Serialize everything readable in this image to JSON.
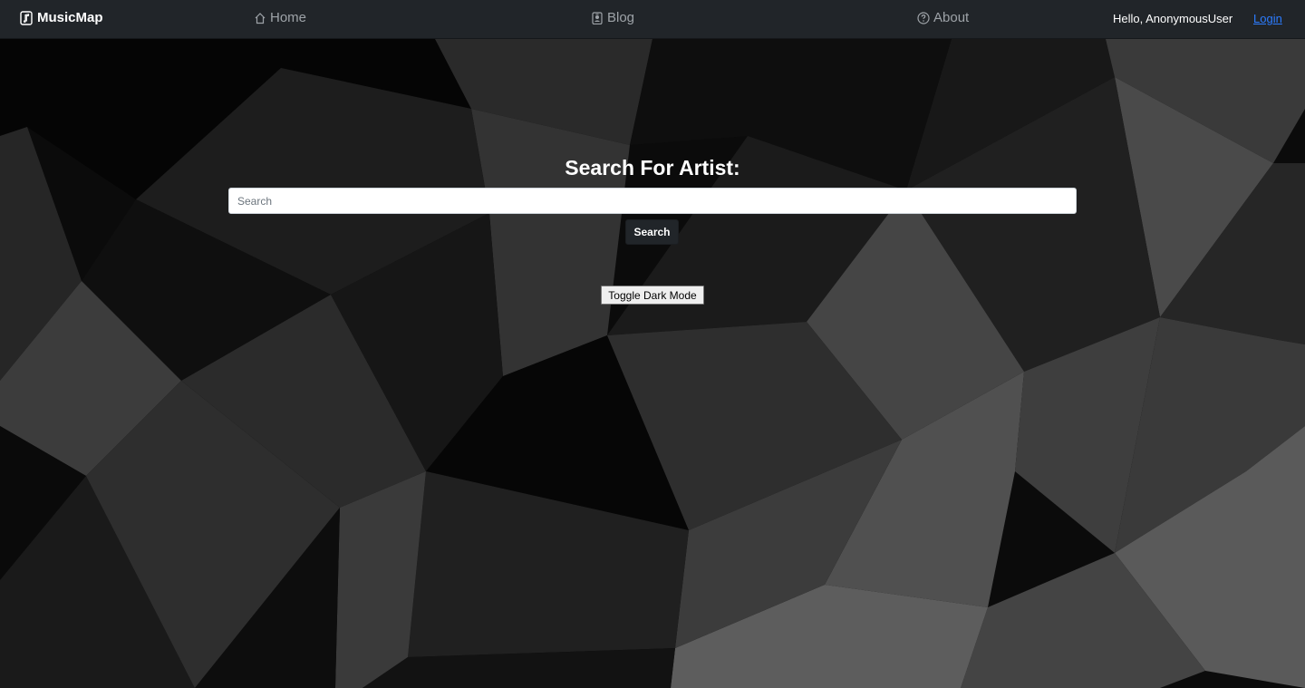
{
  "navbar": {
    "brand": "MusicMap",
    "links": {
      "home": "Home",
      "blog": "Blog",
      "about": "About"
    },
    "greeting": "Hello, AnonymousUser",
    "login": "Login"
  },
  "main": {
    "heading": "Search For Artist:",
    "search_placeholder": "Search",
    "search_button": "Search",
    "toggle_button": "Toggle Dark Mode"
  },
  "colors": {
    "navbar_bg": "#212529",
    "link_muted": "#9ea3a8",
    "login_link": "#2c7cff"
  },
  "icons": {
    "brand": "music-file-icon",
    "home": "home-icon",
    "blog": "person-badge-icon",
    "about": "question-circle-icon"
  }
}
